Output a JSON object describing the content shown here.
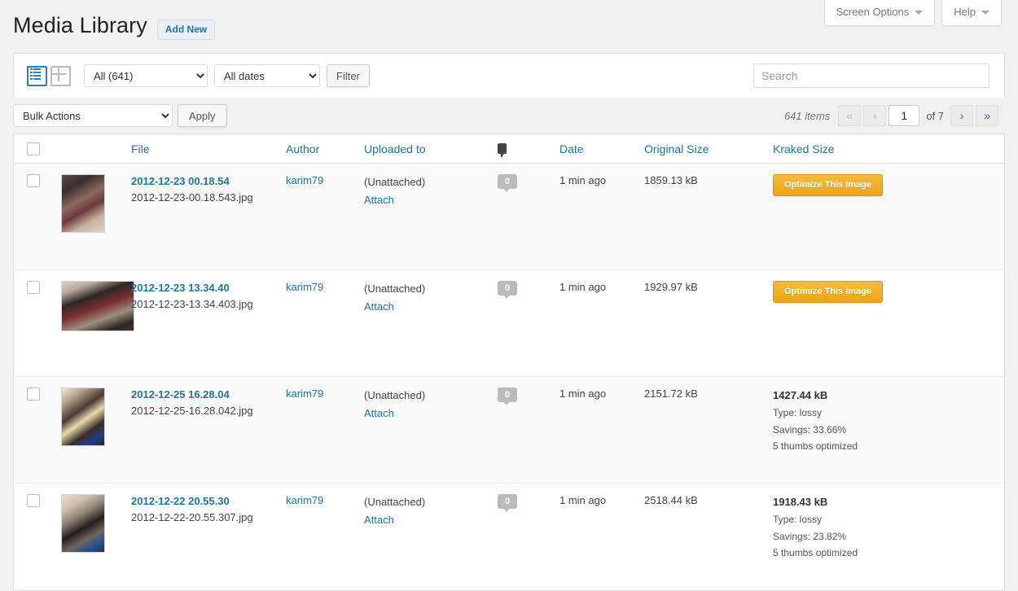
{
  "screen_meta": {
    "screen_options_label": "Screen Options",
    "help_label": "Help"
  },
  "header": {
    "title": "Media Library",
    "add_new_label": "Add New"
  },
  "toolbar": {
    "view_list_icon": "list-view-icon",
    "view_grid_icon": "grid-view-icon",
    "filter_all": "All (641)",
    "filter_dates": "All dates",
    "filter_button": "Filter",
    "search_placeholder": "Search",
    "search_value": ""
  },
  "bulk": {
    "bulk_actions_label": "Bulk Actions",
    "apply_label": "Apply"
  },
  "pagination": {
    "items_count": "641 items",
    "first_label": "«",
    "prev_label": "‹",
    "current_page": "1",
    "of_label": "of 7",
    "next_label": "›",
    "last_label": "»"
  },
  "table": {
    "columns": {
      "file": "File",
      "author": "Author",
      "uploaded_to": "Uploaded to",
      "comments_icon": "comment-bubble-icon",
      "date": "Date",
      "original_size": "Original Size",
      "kraked_size": "Kraked Size"
    },
    "rows": [
      {
        "title": "2012-12-23 00.18.54",
        "filename": "2012-12-23-00.18.543.jpg",
        "author": "karim79",
        "uploaded_to": "(Unattached)",
        "attach_label": "Attach",
        "comments": "0",
        "date": "1 min ago",
        "original_size": "1859.13 kB",
        "kraked": {
          "state": "unoptimized",
          "button_label": "Optimize This Image"
        }
      },
      {
        "title": "2012-12-23 13.34.40",
        "filename": "2012-12-23-13.34.403.jpg",
        "author": "karim79",
        "uploaded_to": "(Unattached)",
        "attach_label": "Attach",
        "comments": "0",
        "date": "1 min ago",
        "original_size": "1929.97 kB",
        "kraked": {
          "state": "unoptimized",
          "button_label": "Optimize This Image"
        }
      },
      {
        "title": "2012-12-25 16.28.04",
        "filename": "2012-12-25-16.28.042.jpg",
        "author": "karim79",
        "uploaded_to": "(Unattached)",
        "attach_label": "Attach",
        "comments": "0",
        "date": "1 min ago",
        "original_size": "2151.72 kB",
        "kraked": {
          "state": "optimized",
          "size": "1427.44 kB",
          "type": "Type: lossy",
          "savings": "Savings: 33.66%",
          "thumbs": "5 thumbs optimized"
        }
      },
      {
        "title": "2012-12-22 20.55.30",
        "filename": "2012-12-22-20.55.307.jpg",
        "author": "karim79",
        "uploaded_to": "(Unattached)",
        "attach_label": "Attach",
        "comments": "0",
        "date": "1 min ago",
        "original_size": "2518.44 kB",
        "kraked": {
          "state": "optimized",
          "size": "1918.43 kB",
          "type": "Type: lossy",
          "savings": "Savings: 23.82%",
          "thumbs": "5 thumbs optimized"
        }
      }
    ]
  },
  "colors": {
    "link": "#21759b",
    "accent_button": "#f0ad27",
    "page_bg": "#f1f1f1"
  }
}
